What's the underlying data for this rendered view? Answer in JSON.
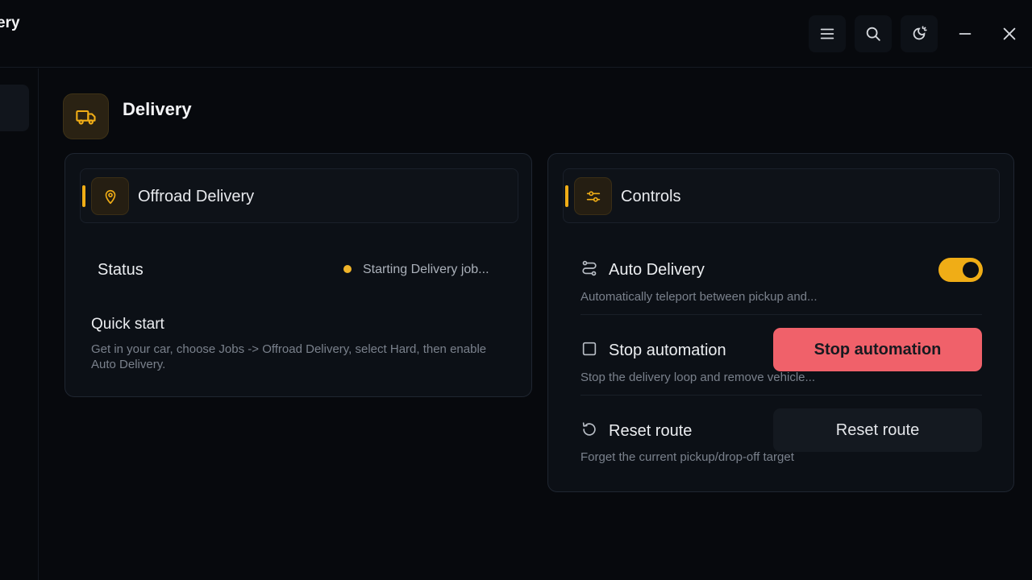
{
  "app": {
    "title": "ery"
  },
  "titlebar_buttons": [
    "menu-icon",
    "search-icon",
    "theme-icon",
    "minimize-icon",
    "close-icon"
  ],
  "page": {
    "title": "Delivery",
    "icon": "truck-icon"
  },
  "left_card": {
    "title": "Offroad Delivery",
    "icon": "location-pin-icon",
    "status_label": "Status",
    "status_value": "Starting Delivery job...",
    "status_color": "#f0b429",
    "quick_start_title": "Quick start",
    "quick_start_text": "Get in your car, choose Jobs -> Offroad Delivery, select Hard, then enable Auto Delivery."
  },
  "controls": {
    "title": "Controls",
    "icon": "sliders-icon",
    "auto_delivery": {
      "label": "Auto Delivery",
      "description": "Automatically teleport between pickup and...",
      "enabled": true
    },
    "stop": {
      "label": "Stop automation",
      "description": "Stop the delivery loop and remove vehicle...",
      "button": "Stop automation"
    },
    "reset": {
      "label": "Reset route",
      "description": "Forget the current pickup/drop-off target",
      "button": "Reset route"
    }
  },
  "colors": {
    "accent": "#f0ad16",
    "danger": "#f0616a",
    "background": "#07090d"
  }
}
